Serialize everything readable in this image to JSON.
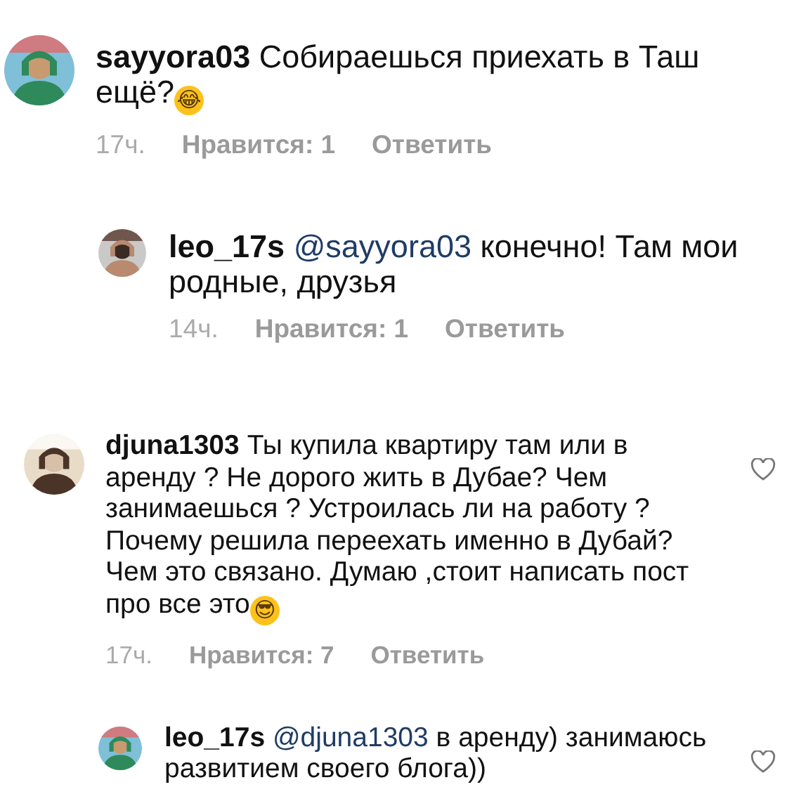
{
  "comments": [
    {
      "kind": "comment",
      "username": "sayyora03",
      "text": "Собираешься приехать в Таш ещё?",
      "emoji": "😂",
      "time": "17ч.",
      "likes": "Нравится: 1",
      "reply_action": "Ответить",
      "heart": false
    },
    {
      "kind": "reply",
      "username": "leo_17s",
      "mention": "@sayyora03",
      "text": "конечно! Там мои родные, друзья",
      "time": "14ч.",
      "likes": "Нравится: 1",
      "reply_action": "Ответить",
      "heart": false
    },
    {
      "kind": "comment",
      "username": "djuna1303",
      "text": "Ты купила квартиру там или в аренду ? Не дорого жить в Дубае? Чем занимаешься ? Устроилась ли на работу ? Почему решила переехать именно в Дубай? Чем это связано. Думаю ,стоит написать пост про все это",
      "emoji": "😎",
      "time": "17ч.",
      "likes": "Нравится: 7",
      "reply_action": "Ответить",
      "heart": true
    },
    {
      "kind": "reply",
      "username": "leo_17s",
      "mention": "@djuna1303",
      "text": "в аренду) занимаюсь развитием своего блога))",
      "heart": true
    }
  ]
}
